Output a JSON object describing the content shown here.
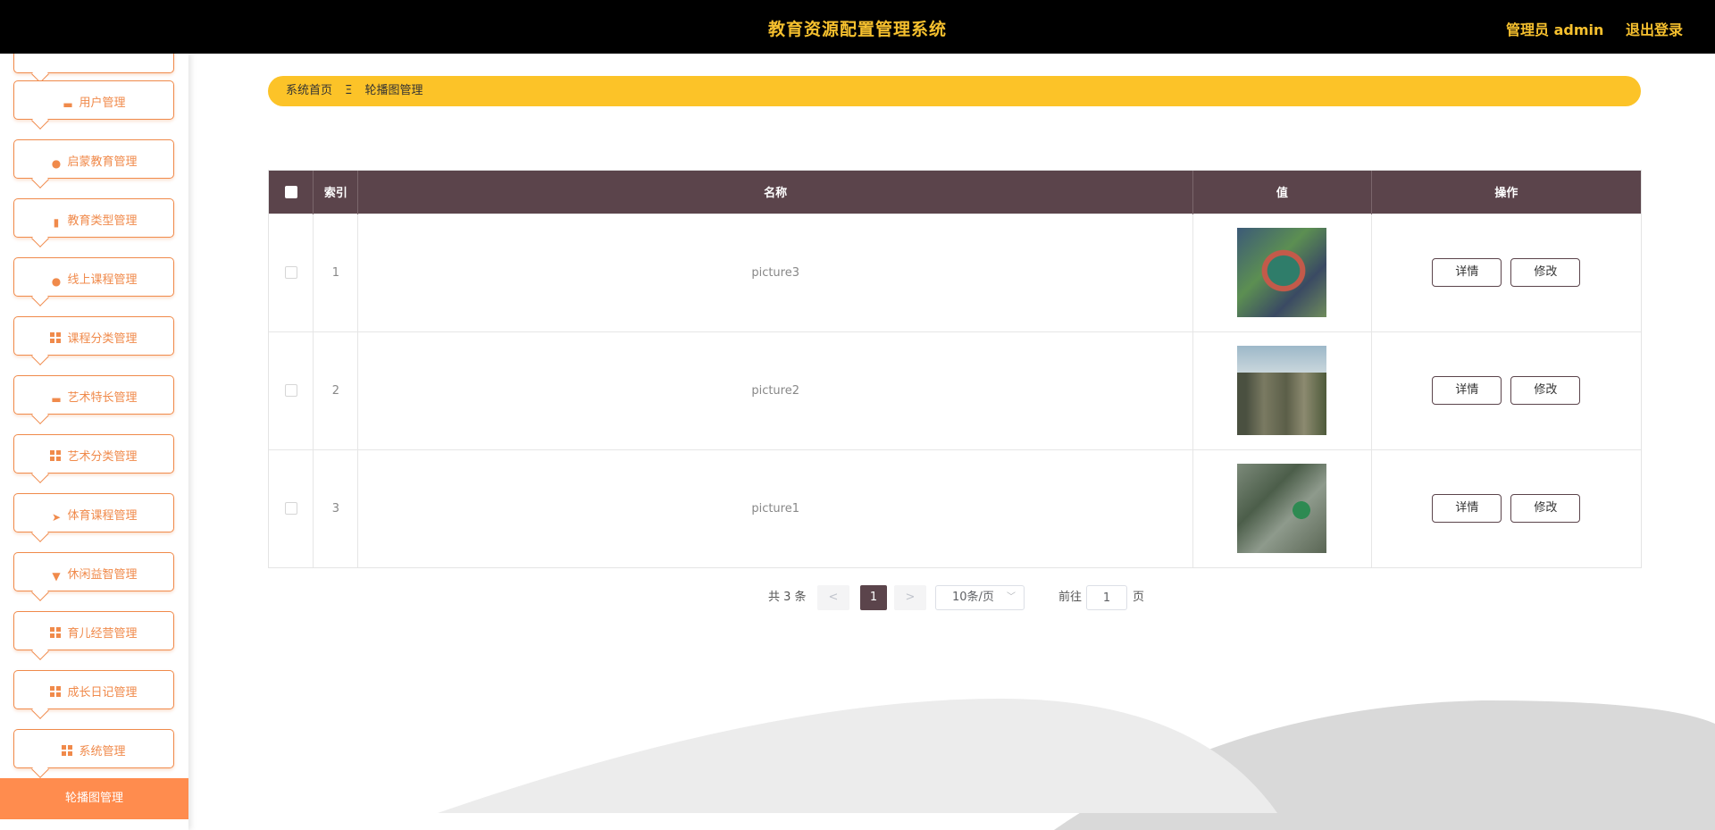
{
  "header": {
    "title": "教育资源配置管理系统",
    "admin_label": "管理员 admin",
    "logout": "退出登录"
  },
  "sidebar": {
    "items": [
      {
        "label": "用户管理",
        "icon": "monitor-icon"
      },
      {
        "label": "启蒙教育管理",
        "icon": "user-icon"
      },
      {
        "label": "教育类型管理",
        "icon": "clipboard-icon"
      },
      {
        "label": "线上课程管理",
        "icon": "leaf-icon"
      },
      {
        "label": "课程分类管理",
        "icon": "grid-icon"
      },
      {
        "label": "艺术特长管理",
        "icon": "briefcase-icon"
      },
      {
        "label": "艺术分类管理",
        "icon": "apps-icon"
      },
      {
        "label": "体育课程管理",
        "icon": "send-icon"
      },
      {
        "label": "休闲益智管理",
        "icon": "brush-icon"
      },
      {
        "label": "育儿经营管理",
        "icon": "grid-icon"
      },
      {
        "label": "成长日记管理",
        "icon": "grid-icon"
      },
      {
        "label": "系统管理",
        "icon": "grid-icon"
      }
    ],
    "active_sub": "轮播图管理"
  },
  "breadcrumb": {
    "home": "系统首页",
    "separator": "Ξ",
    "current": "轮播图管理"
  },
  "table": {
    "columns": [
      "索引",
      "名称",
      "值",
      "操作"
    ],
    "rows": [
      {
        "index": "1",
        "name": "picture3",
        "thumb": "aerial-campus-image"
      },
      {
        "index": "2",
        "name": "picture2",
        "thumb": "building-image"
      },
      {
        "index": "3",
        "name": "picture1",
        "thumb": "aerial-school-image"
      }
    ],
    "detail_label": "详情",
    "edit_label": "修改"
  },
  "pagination": {
    "total": "共 3 条",
    "prev": "<",
    "current_page": "1",
    "next": ">",
    "page_size": "10条/页",
    "goto_label": "前往",
    "goto_value": "1",
    "page_suffix": "页"
  },
  "colors": {
    "header_bg": "#000000",
    "title_yellow": "#f6c02e",
    "accent_orange": "#f08a4b",
    "breadcrumb_bg": "#fcc328",
    "table_header_bg": "#5b444b"
  }
}
